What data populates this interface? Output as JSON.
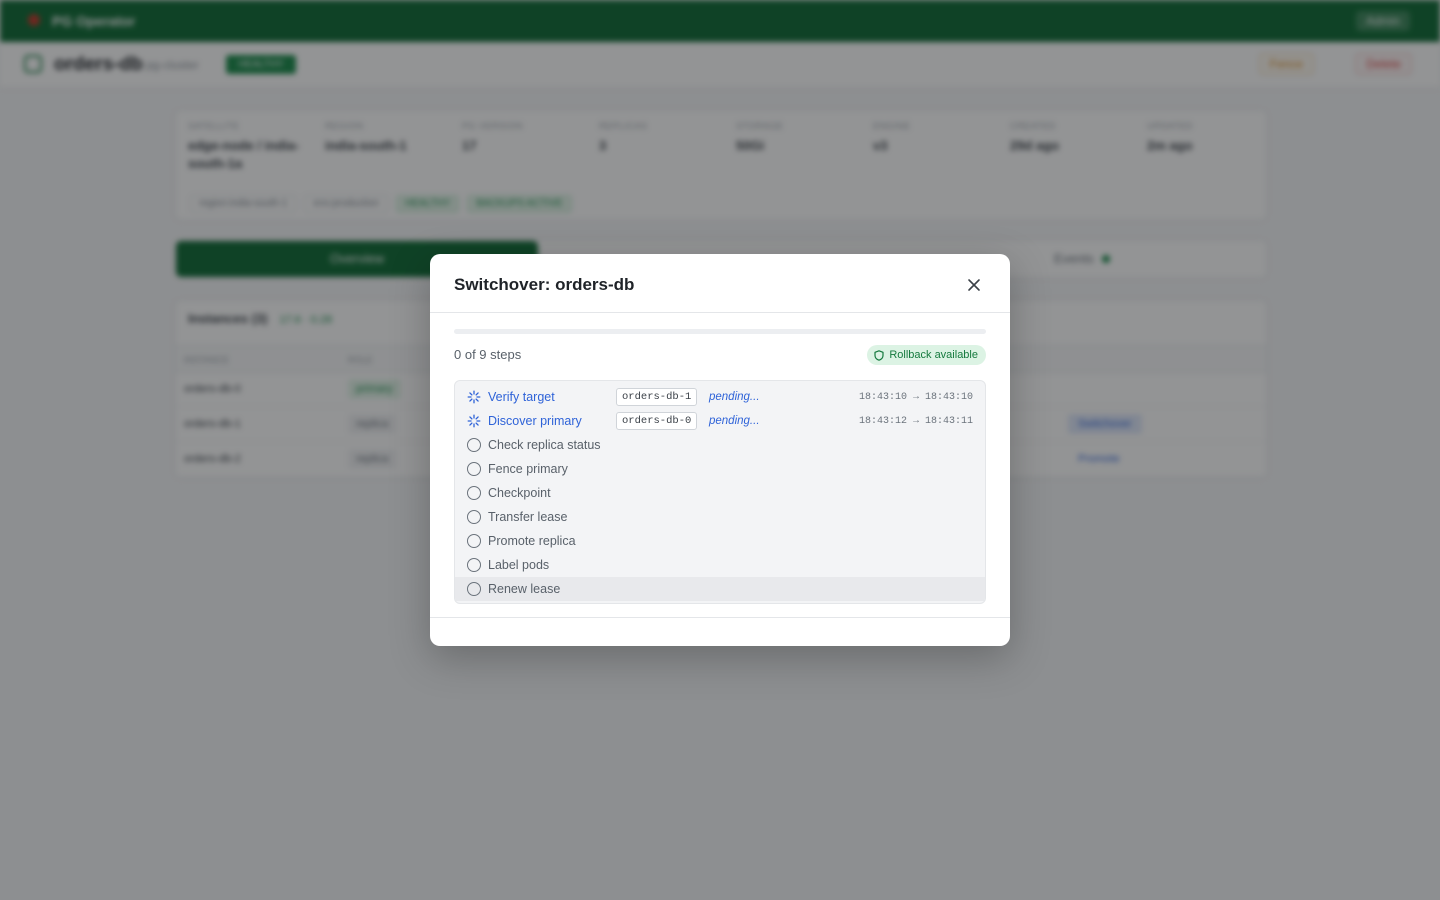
{
  "app": {
    "brand": "PG Operator",
    "user_label": "Admin"
  },
  "db_header": {
    "name": "orders-db",
    "subtitle": "pg-cluster",
    "status_badge": "HEALTHY",
    "fence_label": "Fence",
    "delete_label": "Delete"
  },
  "stats": [
    {
      "key": "SATELLITE",
      "value": "edge-node / india-south-1a"
    },
    {
      "key": "REGION",
      "value": "india-south-1"
    },
    {
      "key": "PG VERSION",
      "value": "17"
    },
    {
      "key": "REPLICAS",
      "value": "3"
    },
    {
      "key": "STORAGE",
      "value": "50Gi"
    },
    {
      "key": "ENGINE",
      "value": "v3"
    },
    {
      "key": "CREATED",
      "value": "29d ago"
    },
    {
      "key": "UPDATED",
      "value": "2m ago"
    }
  ],
  "tags": [
    {
      "label": "region:india-south-1",
      "green": false
    },
    {
      "label": "env:production",
      "green": false
    },
    {
      "label": "HEALTHY",
      "green": true
    },
    {
      "label": "BACKUPS ACTIVE",
      "green": true
    }
  ],
  "tabs": {
    "overview": "Overview",
    "events": "Events"
  },
  "instances": {
    "title": "Instances (3)",
    "version": "17.6 · 0.28",
    "columns": [
      "INSTANCE",
      "ROLE"
    ],
    "rows": [
      {
        "name": "orders-db-0",
        "role": "primary",
        "role_class": "primary",
        "action": ""
      },
      {
        "name": "orders-db-1",
        "role": "replica",
        "role_class": "replica",
        "action": "Switchover"
      },
      {
        "name": "orders-db-2",
        "role": "replica",
        "role_class": "replica",
        "action": "Promote"
      }
    ]
  },
  "modal": {
    "title": "Switchover: orders-db",
    "progress_text": "0 of 9 steps",
    "progress": {
      "completed": 0,
      "total": 9
    },
    "rollback_label": "Rollback available",
    "steps": [
      {
        "label": "Verify target",
        "state": "active",
        "pod": "orders-db-1",
        "status": "pending...",
        "time": "18:43:10 → 18:43:10"
      },
      {
        "label": "Discover primary",
        "state": "active",
        "pod": "orders-db-0",
        "status": "pending...",
        "time": "18:43:12 → 18:43:11"
      },
      {
        "label": "Check replica status",
        "state": "idle"
      },
      {
        "label": "Fence primary",
        "state": "idle"
      },
      {
        "label": "Checkpoint",
        "state": "idle"
      },
      {
        "label": "Transfer lease",
        "state": "idle"
      },
      {
        "label": "Promote replica",
        "state": "idle"
      },
      {
        "label": "Label pods",
        "state": "idle"
      },
      {
        "label": "Renew lease",
        "state": "idle"
      }
    ]
  },
  "colors": {
    "brand_green": "#0f6b35",
    "active_blue": "#2f63d8",
    "rollback_bg": "#dcf3e4"
  }
}
